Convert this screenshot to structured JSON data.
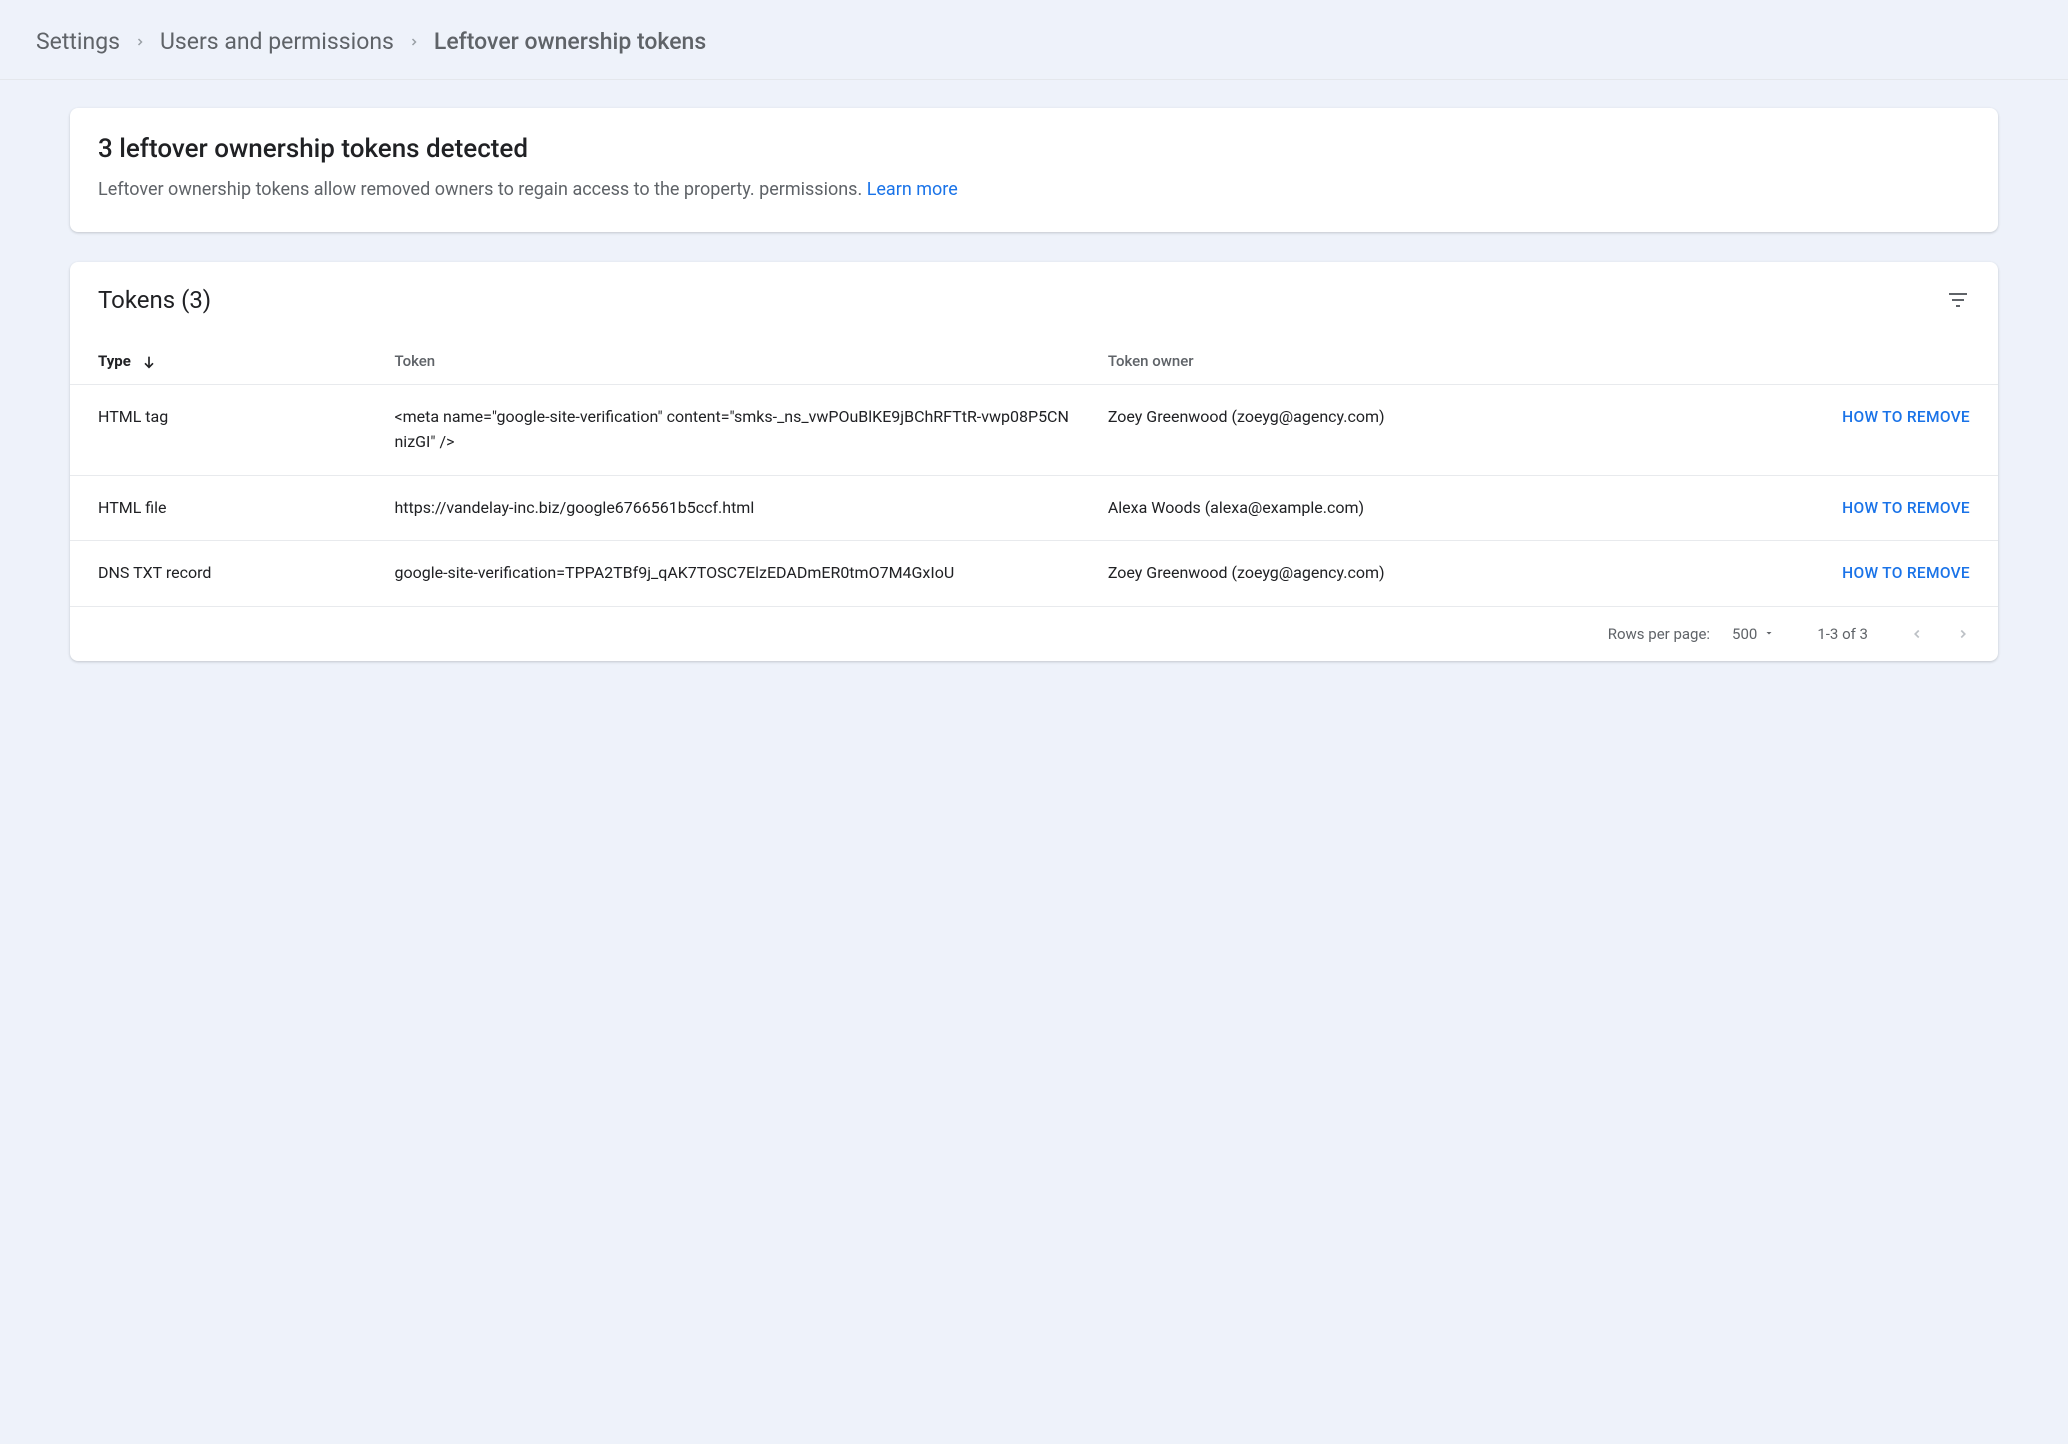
{
  "breadcrumb": {
    "items": [
      {
        "label": "Settings"
      },
      {
        "label": "Users and permissions"
      },
      {
        "label": "Leftover ownership tokens"
      }
    ]
  },
  "info": {
    "title": "3 leftover ownership tokens detected",
    "description": "Leftover ownership tokens allow removed owners to regain access to the property. permissions. ",
    "learn_more": "Learn more"
  },
  "table": {
    "title": "Tokens (3)",
    "columns": {
      "type": "Type",
      "token": "Token",
      "owner": "Token owner"
    },
    "rows": [
      {
        "type": "HTML tag",
        "token": "<meta name=\"google-site-verification\" content=\"smks-_ns_vwPOuBlKE9jBChRFTtR-vwp08P5CNnizGI\" />",
        "owner": "Zoey Greenwood (zoeyg@agency.com)",
        "action": "HOW TO REMOVE"
      },
      {
        "type": "HTML file",
        "token": "https://vandelay-inc.biz/google6766561b5ccf.html",
        "owner": "Alexa Woods (alexa@example.com)",
        "action": "HOW TO REMOVE"
      },
      {
        "type": "DNS TXT record",
        "token": "google-site-verification=TPPA2TBf9j_qAK7TOSC7ElzEDADmER0tmO7M4GxIoU",
        "owner": "Zoey Greenwood (zoeyg@agency.com)",
        "action": "HOW TO REMOVE"
      }
    ]
  },
  "pagination": {
    "rows_label": "Rows per page:",
    "rows_value": "500",
    "range": "1-3 of 3"
  }
}
